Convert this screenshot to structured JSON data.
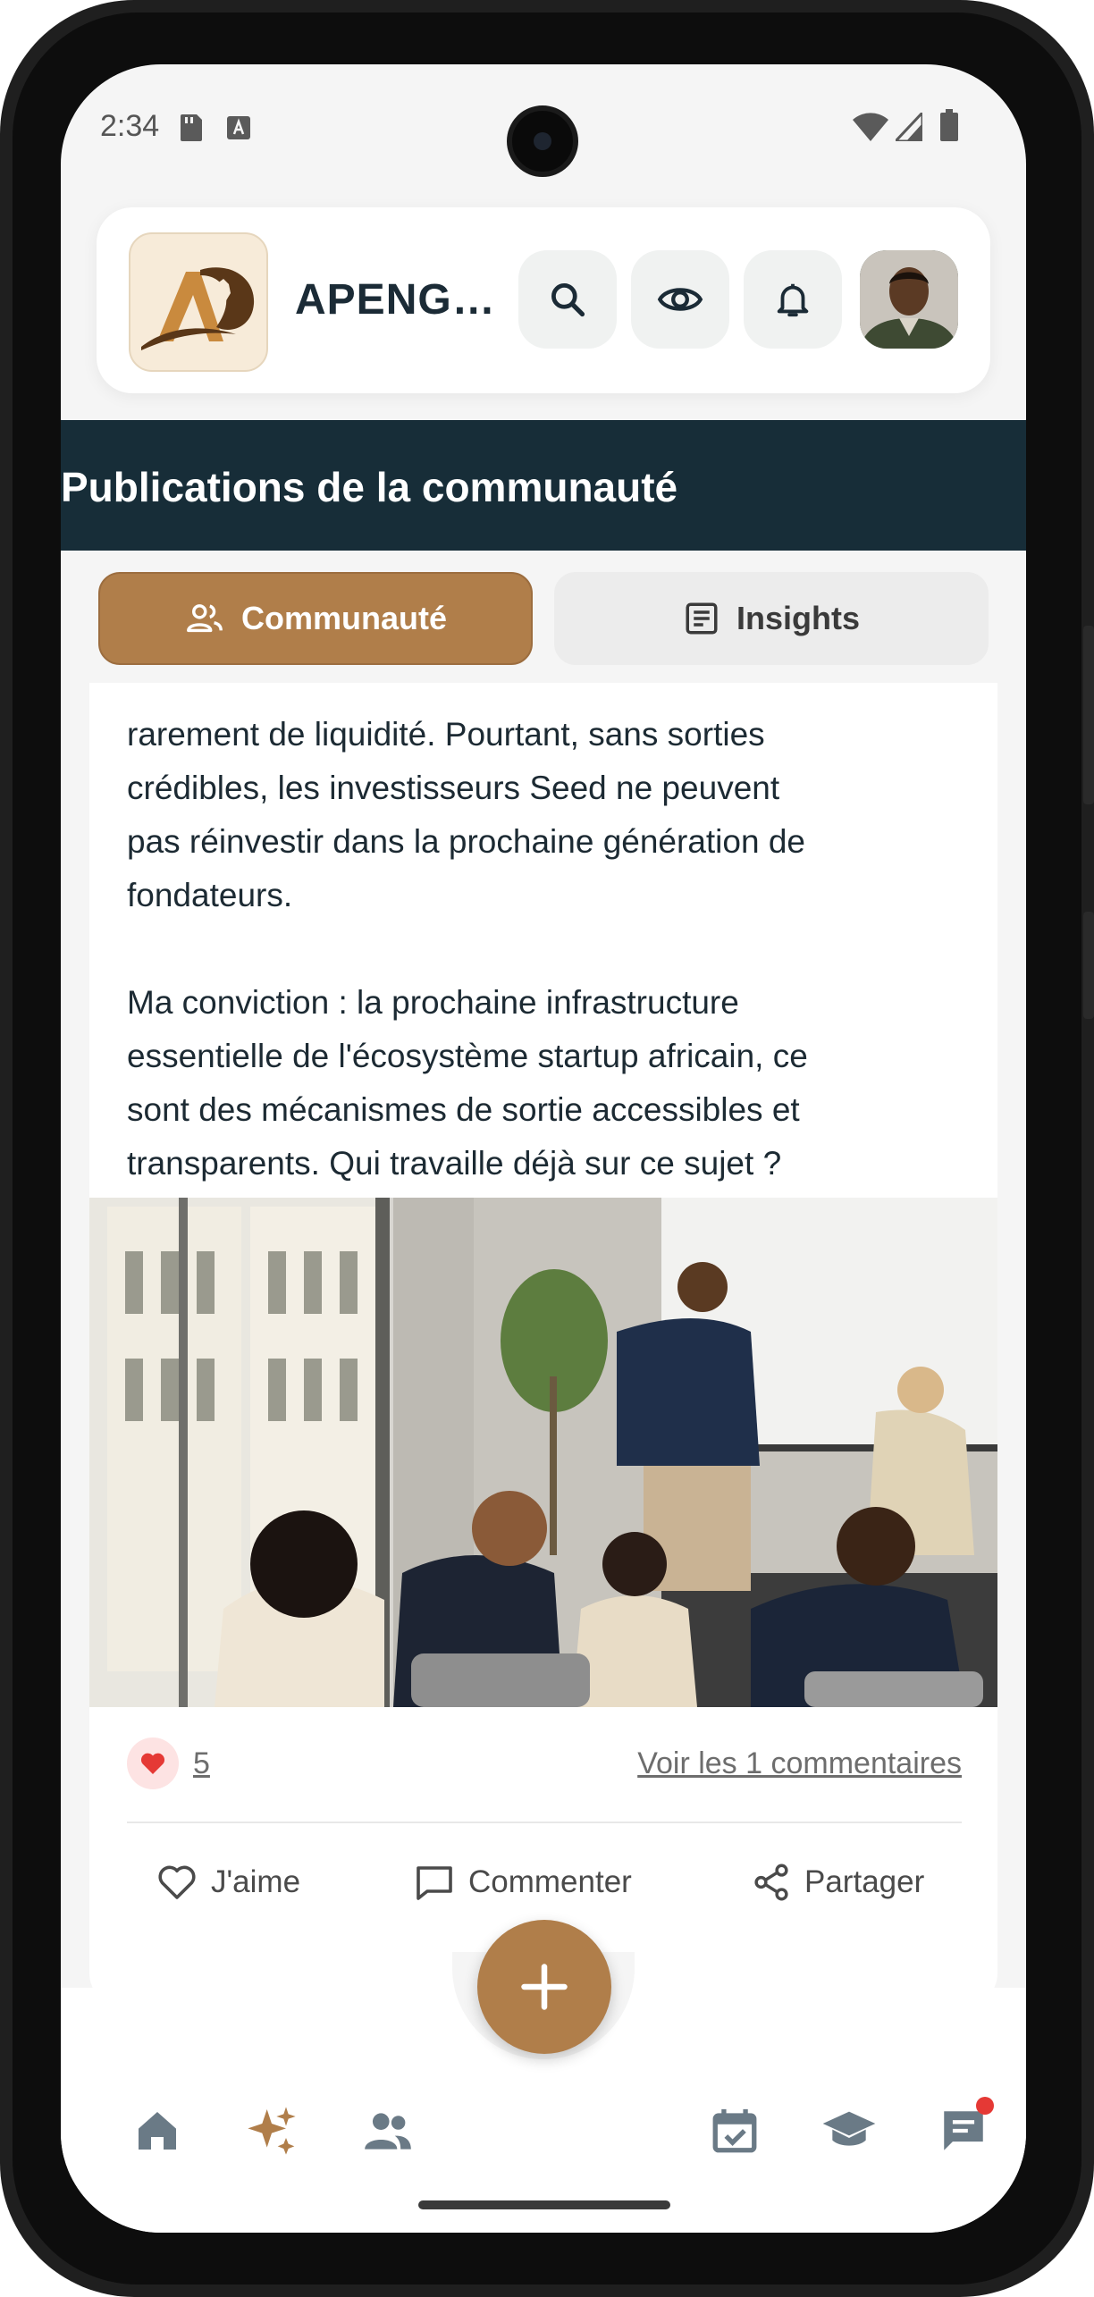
{
  "status_bar": {
    "time": "2:34"
  },
  "header": {
    "brand": "APENGA...",
    "logo_letters": "AD"
  },
  "section": {
    "title": "Publications de la communauté"
  },
  "tabs": [
    {
      "label": "Communauté",
      "active": true
    },
    {
      "label": "Insights",
      "active": false
    }
  ],
  "post": {
    "body": "rarement de liquidité. Pourtant, sans sorties\ncrédibles, les investisseurs Seed ne peuvent\npas réinvestir dans la prochaine génération de\nfondateurs.\n\nMa conviction : la prochaine infrastructure\nessentielle de l'écosystème startup africain, ce\nsont des mécanismes de sortie accessibles et\ntransparents. Qui travaille déjà sur ce sujet ?",
    "likes": "5",
    "comments_link": "Voir les 1 commentaires",
    "actions": {
      "like": "J'aime",
      "comment": "Commenter",
      "share": "Partager"
    }
  },
  "colors": {
    "accent": "#b07e4a",
    "section_bg": "#172d38",
    "heart": "#e53935"
  },
  "icons": [
    "search-icon",
    "eye-icon",
    "bell-icon",
    "home-icon",
    "sparkles-icon",
    "people-icon",
    "plus-icon",
    "calendar-check-icon",
    "graduation-cap-icon",
    "chat-icon"
  ]
}
